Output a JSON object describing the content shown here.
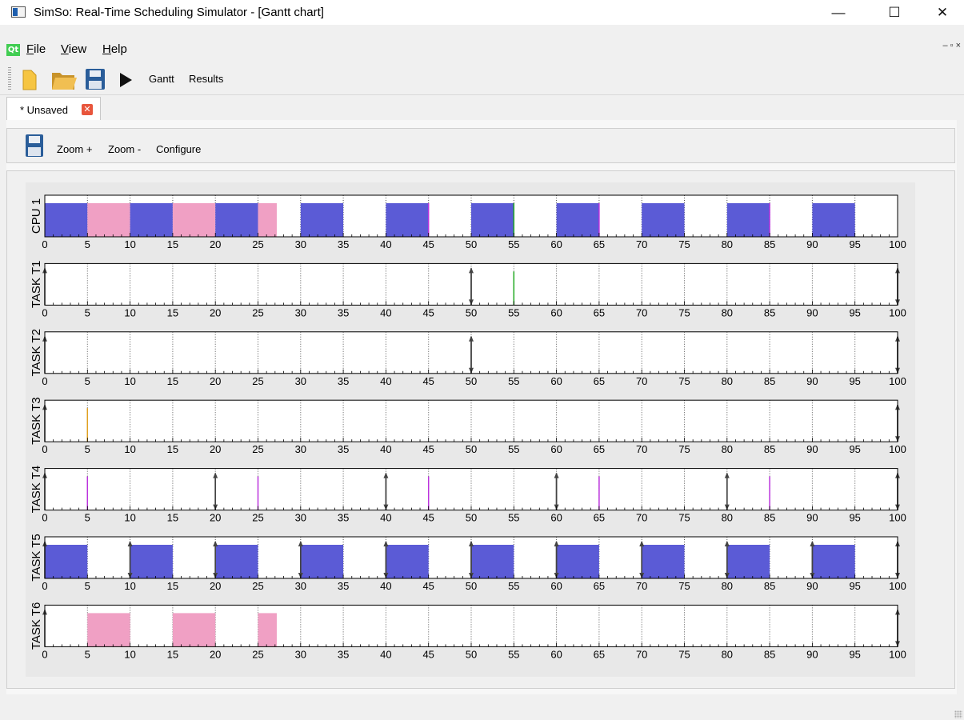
{
  "window": {
    "title": "SimSo: Real-Time Scheduling Simulator - [Gantt chart]",
    "minimize": "—",
    "maximize": "☐",
    "close": "✕"
  },
  "menu": {
    "items": [
      "File",
      "View",
      "Help"
    ],
    "mdi_controls": "– ▫ ×"
  },
  "toolbar": {
    "icons": [
      "new-icon",
      "open-icon",
      "save-icon",
      "run-icon"
    ],
    "gantt_label": "Gantt",
    "results_label": "Results"
  },
  "tab": {
    "label": "* Unsaved",
    "close": "✕"
  },
  "gantt_toolbar": {
    "save_icon": "save-icon",
    "zoom_in": "Zoom +",
    "zoom_out": "Zoom -",
    "configure": "Configure"
  },
  "colors": {
    "blue": "#5b5bd6",
    "pink": "#f0a0c4",
    "green": "#22aa22",
    "purple": "#bb33dd",
    "orange": "#e0a020",
    "grid": "#555555"
  },
  "chart_data": {
    "type": "gantt",
    "xlim": [
      0,
      100
    ],
    "x_ticks": [
      "0",
      "5",
      "10",
      "15",
      "20",
      "25",
      "30",
      "35",
      "40",
      "45",
      "50",
      "55",
      "60",
      "65",
      "70",
      "75",
      "80",
      "85",
      "90",
      "95",
      "100"
    ],
    "rows": [
      {
        "name": "CPU 1",
        "blocks": [
          {
            "start": 0,
            "end": 5,
            "color": "blue"
          },
          {
            "start": 5,
            "end": 10,
            "color": "pink"
          },
          {
            "start": 10,
            "end": 15,
            "color": "blue"
          },
          {
            "start": 15,
            "end": 20,
            "color": "pink"
          },
          {
            "start": 20,
            "end": 25,
            "color": "blue"
          },
          {
            "start": 25,
            "end": 27.2,
            "color": "pink"
          },
          {
            "start": 30,
            "end": 35,
            "color": "blue"
          },
          {
            "start": 40,
            "end": 45,
            "color": "blue"
          },
          {
            "start": 50,
            "end": 55,
            "color": "blue"
          },
          {
            "start": 60,
            "end": 65,
            "color": "blue"
          },
          {
            "start": 70,
            "end": 75,
            "color": "blue"
          },
          {
            "start": 80,
            "end": 85,
            "color": "blue"
          },
          {
            "start": 90,
            "end": 95,
            "color": "blue"
          }
        ],
        "releases": [],
        "deadlines": [],
        "slivers": [
          {
            "x": 45,
            "color": "purple"
          },
          {
            "x": 55,
            "color": "green"
          },
          {
            "x": 65,
            "color": "purple"
          },
          {
            "x": 85,
            "color": "purple"
          }
        ]
      },
      {
        "name": "TASK T1",
        "blocks": [],
        "releases": [
          0,
          50,
          100
        ],
        "deadlines": [
          50,
          100
        ],
        "slivers": [
          {
            "x": 55,
            "color": "green"
          }
        ]
      },
      {
        "name": "TASK T2",
        "blocks": [],
        "releases": [
          0,
          50,
          100
        ],
        "deadlines": [
          50,
          100
        ],
        "slivers": []
      },
      {
        "name": "TASK T3",
        "blocks": [],
        "releases": [
          0,
          100
        ],
        "deadlines": [
          100
        ],
        "slivers": [
          {
            "x": 5,
            "color": "orange"
          }
        ]
      },
      {
        "name": "TASK T4",
        "blocks": [],
        "releases": [
          0,
          20,
          40,
          60,
          80,
          100
        ],
        "deadlines": [
          20,
          40,
          60,
          80,
          100
        ],
        "slivers": [
          {
            "x": 5,
            "color": "purple"
          },
          {
            "x": 25,
            "color": "purple"
          },
          {
            "x": 45,
            "color": "purple"
          },
          {
            "x": 65,
            "color": "purple"
          },
          {
            "x": 85,
            "color": "purple"
          }
        ]
      },
      {
        "name": "TASK T5",
        "blocks": [
          {
            "start": 0,
            "end": 5,
            "color": "blue"
          },
          {
            "start": 10,
            "end": 15,
            "color": "blue"
          },
          {
            "start": 20,
            "end": 25,
            "color": "blue"
          },
          {
            "start": 30,
            "end": 35,
            "color": "blue"
          },
          {
            "start": 40,
            "end": 45,
            "color": "blue"
          },
          {
            "start": 50,
            "end": 55,
            "color": "blue"
          },
          {
            "start": 60,
            "end": 65,
            "color": "blue"
          },
          {
            "start": 70,
            "end": 75,
            "color": "blue"
          },
          {
            "start": 80,
            "end": 85,
            "color": "blue"
          },
          {
            "start": 90,
            "end": 95,
            "color": "blue"
          }
        ],
        "releases": [
          0,
          10,
          20,
          30,
          40,
          50,
          60,
          70,
          80,
          90,
          100
        ],
        "deadlines": [
          10,
          20,
          30,
          40,
          50,
          60,
          70,
          80,
          90,
          100
        ],
        "slivers": []
      },
      {
        "name": "TASK T6",
        "blocks": [
          {
            "start": 5,
            "end": 10,
            "color": "pink"
          },
          {
            "start": 15,
            "end": 20,
            "color": "pink"
          },
          {
            "start": 25,
            "end": 27.2,
            "color": "pink"
          }
        ],
        "releases": [
          0,
          100
        ],
        "deadlines": [
          100
        ],
        "slivers": []
      }
    ]
  }
}
